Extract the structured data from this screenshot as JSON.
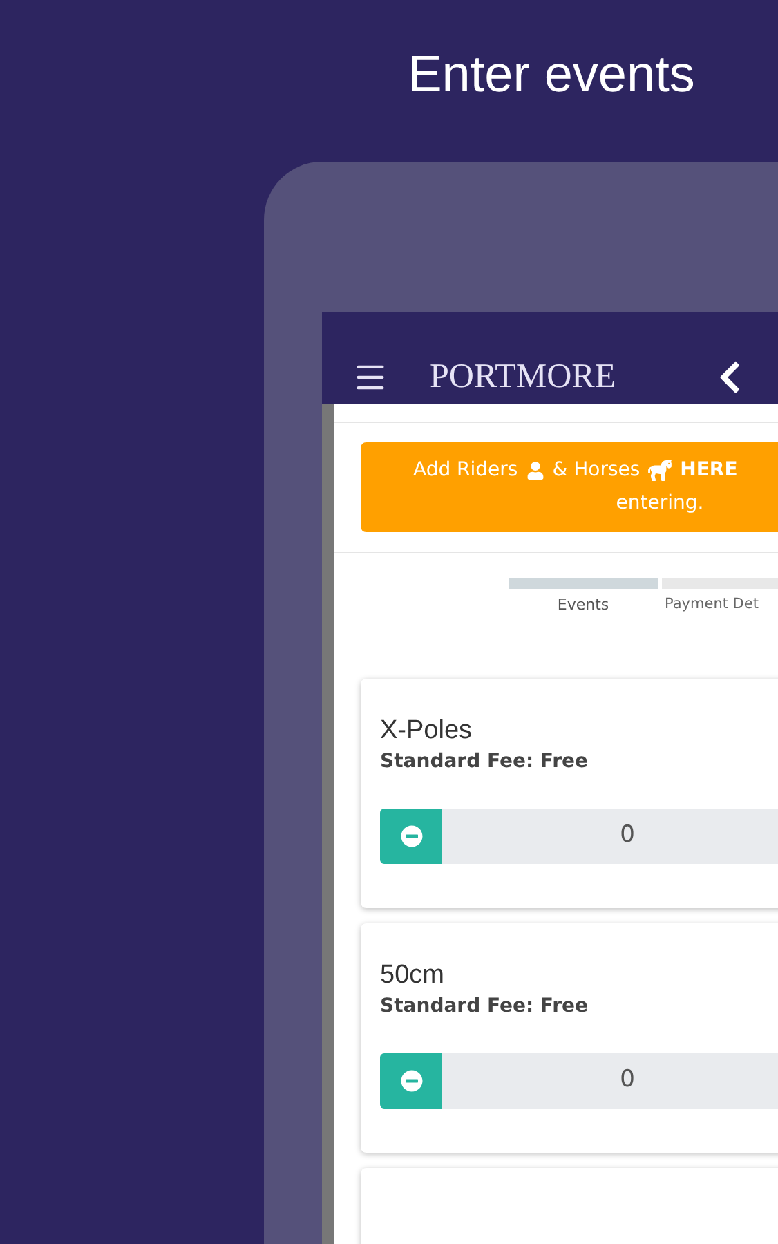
{
  "heading": "Enter events",
  "app_bar": {
    "title": "PORTMORE"
  },
  "banner": {
    "parts": [
      {
        "kind": "text",
        "text": "Add Riders"
      },
      {
        "kind": "rider"
      },
      {
        "kind": "text",
        "text": "& Horses"
      },
      {
        "kind": "horse"
      },
      {
        "kind": "bold",
        "text": "HERE"
      }
    ],
    "second_line": "entering."
  },
  "steps": [
    {
      "label": "Events",
      "selected": true
    },
    {
      "label": "Payment Det",
      "selected": false
    }
  ],
  "events": [
    {
      "name": "X-Poles",
      "fee": "Standard Fee: Free",
      "count": "0"
    },
    {
      "name": "50cm",
      "fee": "Standard Fee: Free",
      "count": "0"
    }
  ]
}
